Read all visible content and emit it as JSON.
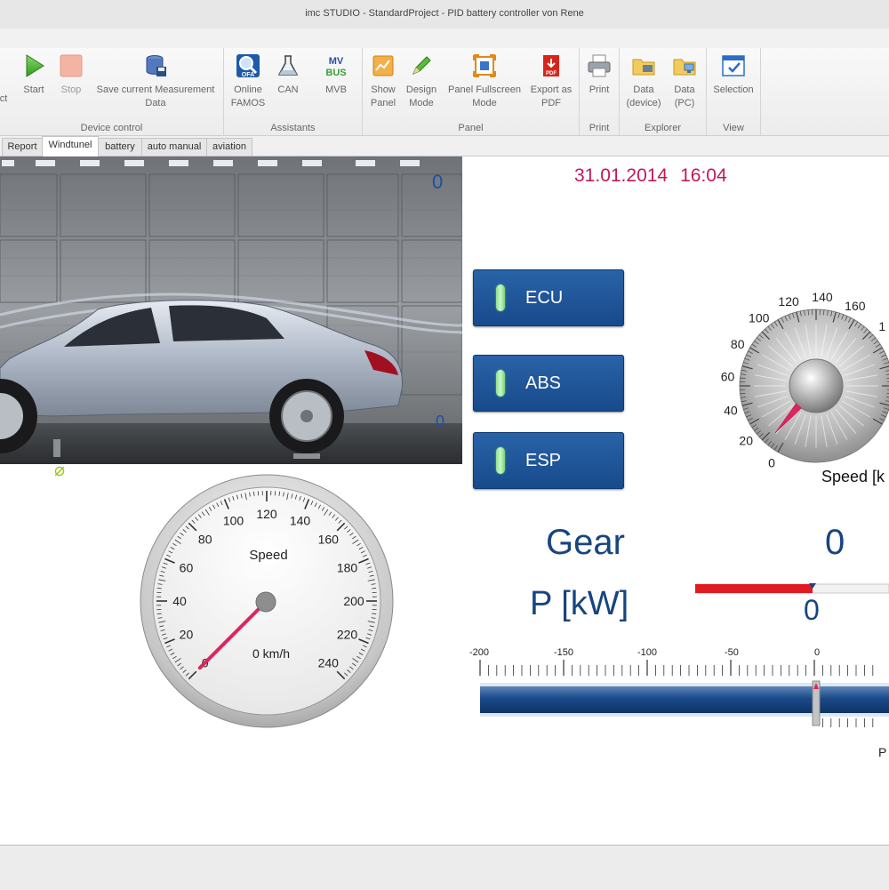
{
  "window": {
    "title": "imc STUDIO - StandardProject - PID battery controller von Rene"
  },
  "ribbon": {
    "device_control": {
      "label": "Device control",
      "cut_text": "ct",
      "start": "Start",
      "stop": "Stop",
      "save_line1": "Save current Measurement",
      "save_line2": "Data"
    },
    "assistants": {
      "label": "Assistants",
      "online_famos_line1": "Online",
      "online_famos_line2": "FAMOS",
      "can": "CAN",
      "mvb": "MVB",
      "mvb_icon_text1": "MV",
      "mvb_icon_text2": "BUS"
    },
    "panel": {
      "label": "Panel",
      "show_line1": "Show",
      "show_line2": "Panel",
      "design_line1": "Design",
      "design_line2": "Mode",
      "fullscreen_line1": "Panel Fullscreen",
      "fullscreen_line2": "Mode",
      "export_line1": "Export as",
      "export_line2": "PDF",
      "pdf_icon_text": "PDF"
    },
    "print": {
      "label": "Print",
      "print": "Print"
    },
    "explorer": {
      "label": "Explorer",
      "device_line1": "Data",
      "device_line2": "(device)",
      "pc_line1": "Data",
      "pc_line2": "(PC)"
    },
    "view": {
      "label": "View",
      "selection": "Selection"
    }
  },
  "tabs": [
    {
      "label": "Report",
      "active": false
    },
    {
      "label": "Windtunel",
      "active": true
    },
    {
      "label": "battery",
      "active": false
    },
    {
      "label": "auto manual",
      "active": false
    },
    {
      "label": "aviation",
      "active": false
    }
  ],
  "panel": {
    "date": "31.01.2014",
    "time": "16:04",
    "image_corner_top": "0",
    "image_corner_bottom": "0",
    "ok_symbol": "⌀",
    "ecu": "ECU",
    "abs": "ABS",
    "esp": "ESP",
    "gear_label": "Gear",
    "gear_value": "0",
    "power_label": "P [kW]",
    "power_value": "0",
    "power_scale_ticks": [
      "-200",
      "-150",
      "-100",
      "-50",
      "0"
    ],
    "power_axis_label": "P",
    "speedo": {
      "title": "Speed",
      "readout": "0 km/h",
      "ticks": [
        "0",
        "20",
        "40",
        "60",
        "80",
        "100",
        "120",
        "140",
        "160",
        "180",
        "200",
        "220",
        "240"
      ],
      "value_kmh": 0
    },
    "knob": {
      "label": "Speed [k",
      "ticks": [
        "0",
        "20",
        "40",
        "60",
        "80",
        "100",
        "120",
        "140",
        "160",
        "1"
      ],
      "value": 10
    }
  },
  "colors": {
    "accent_blue": "#17457f",
    "date_magenta": "#c2185b",
    "needle_red": "#e0245e",
    "led_green": "#8ee28e"
  }
}
